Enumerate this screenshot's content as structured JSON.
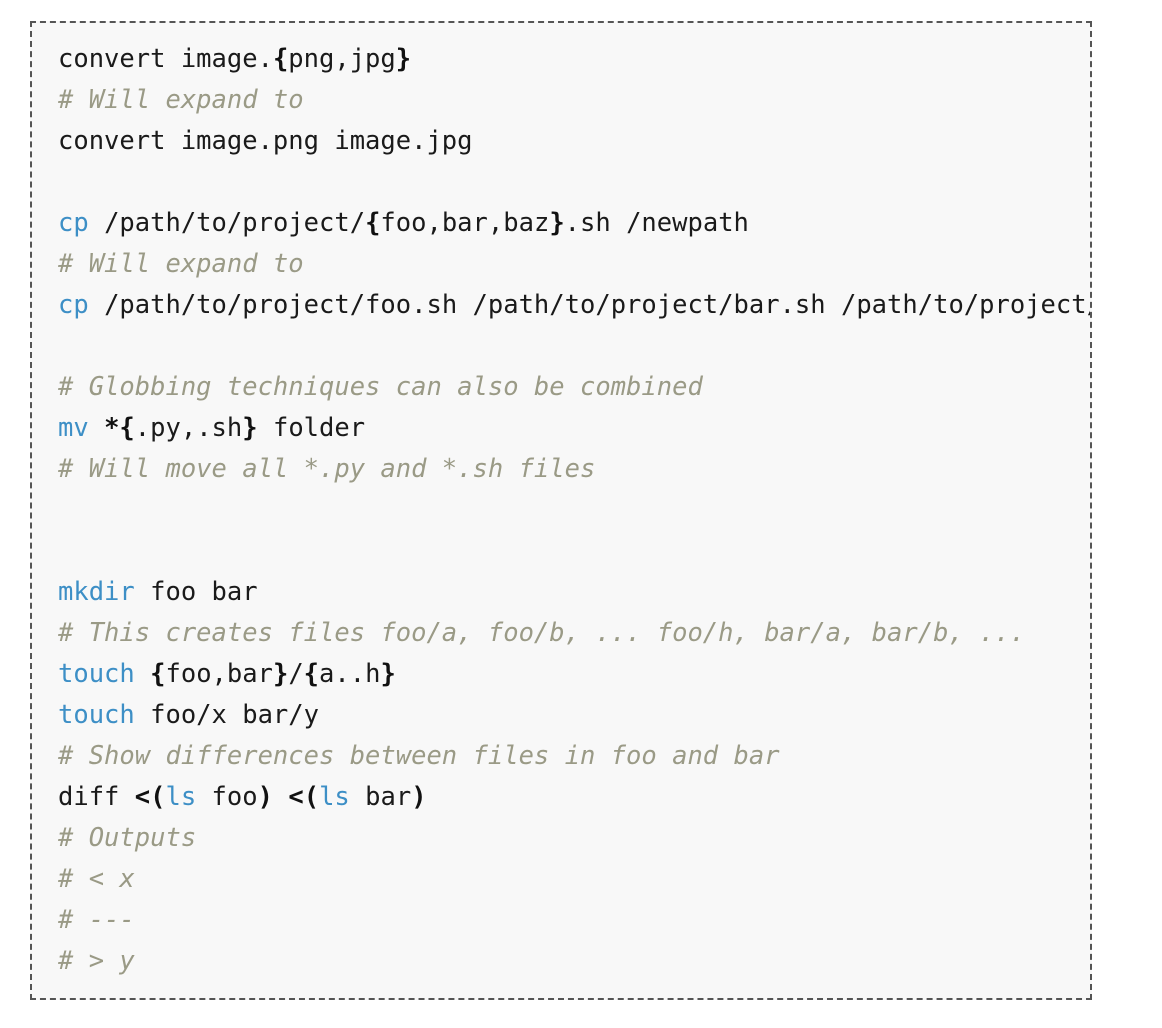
{
  "block": {
    "language": "bash",
    "border_color": "#555555",
    "background_color": "#f8f8f8",
    "page_background": "#ffffff",
    "colors": {
      "command": "#3d8fc6",
      "punctuation": "#111111",
      "plain_text": "#1a1a1a",
      "comment": "#9a9a86"
    }
  },
  "lines": [
    {
      "id": "line-1",
      "text": "convert image.{png,jpg}",
      "tokens": [
        {
          "t": "convert image.",
          "c": "plain"
        },
        {
          "t": "{",
          "c": "punct"
        },
        {
          "t": "png,jpg",
          "c": "plain"
        },
        {
          "t": "}",
          "c": "punct"
        }
      ]
    },
    {
      "id": "line-2",
      "text": "# Will expand to",
      "tokens": [
        {
          "t": "# Will expand to",
          "c": "cmt"
        }
      ]
    },
    {
      "id": "line-3",
      "text": "convert image.png image.jpg",
      "tokens": [
        {
          "t": "convert image.png image.jpg",
          "c": "plain"
        }
      ]
    },
    {
      "id": "line-4",
      "text": "",
      "tokens": []
    },
    {
      "id": "line-5",
      "text": "cp /path/to/project/{foo,bar,baz}.sh /newpath",
      "tokens": [
        {
          "t": "cp",
          "c": "cmd"
        },
        {
          "t": " /path/to/project/",
          "c": "plain"
        },
        {
          "t": "{",
          "c": "punct"
        },
        {
          "t": "foo,bar,baz",
          "c": "plain"
        },
        {
          "t": "}",
          "c": "punct"
        },
        {
          "t": ".sh /newpath",
          "c": "plain"
        }
      ]
    },
    {
      "id": "line-6",
      "text": "# Will expand to",
      "tokens": [
        {
          "t": "# Will expand to",
          "c": "cmt"
        }
      ]
    },
    {
      "id": "line-7",
      "text": "cp /path/to/project/foo.sh /path/to/project/bar.sh /path/to/project/baz.sh /newpath",
      "tokens": [
        {
          "t": "cp",
          "c": "cmd"
        },
        {
          "t": " /path/to/project/foo.sh /path/to/project/bar.sh /path/to/project/baz.sh /newpath",
          "c": "plain"
        }
      ]
    },
    {
      "id": "line-8",
      "text": "",
      "tokens": []
    },
    {
      "id": "line-9",
      "text": "# Globbing techniques can also be combined",
      "tokens": [
        {
          "t": "# Globbing techniques can also be combined",
          "c": "cmt"
        }
      ]
    },
    {
      "id": "line-10",
      "text": "mv *{.py,.sh} folder",
      "tokens": [
        {
          "t": "mv",
          "c": "cmd"
        },
        {
          "t": " ",
          "c": "plain"
        },
        {
          "t": "*{",
          "c": "punct"
        },
        {
          "t": ".py,.sh",
          "c": "plain"
        },
        {
          "t": "}",
          "c": "punct"
        },
        {
          "t": " folder",
          "c": "plain"
        }
      ]
    },
    {
      "id": "line-11",
      "text": "# Will move all *.py and *.sh files",
      "tokens": [
        {
          "t": "# Will move all *.py and *.sh files",
          "c": "cmt"
        }
      ]
    },
    {
      "id": "line-12",
      "text": "",
      "tokens": []
    },
    {
      "id": "line-13",
      "text": "",
      "tokens": []
    },
    {
      "id": "line-14",
      "text": "mkdir foo bar",
      "tokens": [
        {
          "t": "mkdir",
          "c": "cmd"
        },
        {
          "t": " foo bar",
          "c": "plain"
        }
      ]
    },
    {
      "id": "line-15",
      "text": "# This creates files foo/a, foo/b, ... foo/h, bar/a, bar/b, ...",
      "tokens": [
        {
          "t": "# This creates files foo/a, foo/b, ... foo/h, bar/a, bar/b, ...",
          "c": "cmt"
        }
      ]
    },
    {
      "id": "line-16",
      "text": "touch {foo,bar}/{a..h}",
      "tokens": [
        {
          "t": "touch",
          "c": "cmd"
        },
        {
          "t": " ",
          "c": "plain"
        },
        {
          "t": "{",
          "c": "punct"
        },
        {
          "t": "foo,bar",
          "c": "plain"
        },
        {
          "t": "}",
          "c": "punct"
        },
        {
          "t": "/",
          "c": "plain"
        },
        {
          "t": "{",
          "c": "punct"
        },
        {
          "t": "a..h",
          "c": "plain"
        },
        {
          "t": "}",
          "c": "punct"
        }
      ]
    },
    {
      "id": "line-17",
      "text": "touch foo/x bar/y",
      "tokens": [
        {
          "t": "touch",
          "c": "cmd"
        },
        {
          "t": " foo/x bar/y",
          "c": "plain"
        }
      ]
    },
    {
      "id": "line-18",
      "text": "# Show differences between files in foo and bar",
      "tokens": [
        {
          "t": "# Show differences between files in foo and bar",
          "c": "cmt"
        }
      ]
    },
    {
      "id": "line-19",
      "text": "diff <(ls foo) <(ls bar)",
      "tokens": [
        {
          "t": "diff ",
          "c": "plain"
        },
        {
          "t": "<(",
          "c": "punct"
        },
        {
          "t": "ls",
          "c": "cmd"
        },
        {
          "t": " foo",
          "c": "plain"
        },
        {
          "t": ")",
          "c": "punct"
        },
        {
          "t": " ",
          "c": "plain"
        },
        {
          "t": "<(",
          "c": "punct"
        },
        {
          "t": "ls",
          "c": "cmd"
        },
        {
          "t": " bar",
          "c": "plain"
        },
        {
          "t": ")",
          "c": "punct"
        }
      ]
    },
    {
      "id": "line-20",
      "text": "# Outputs",
      "tokens": [
        {
          "t": "# Outputs",
          "c": "cmt"
        }
      ]
    },
    {
      "id": "line-21",
      "text": "# < x",
      "tokens": [
        {
          "t": "# < x",
          "c": "cmt"
        }
      ]
    },
    {
      "id": "line-22",
      "text": "# ---",
      "tokens": [
        {
          "t": "# ---",
          "c": "cmt"
        }
      ]
    },
    {
      "id": "line-23",
      "text": "# > y",
      "tokens": [
        {
          "t": "# > y",
          "c": "cmt"
        }
      ]
    }
  ]
}
